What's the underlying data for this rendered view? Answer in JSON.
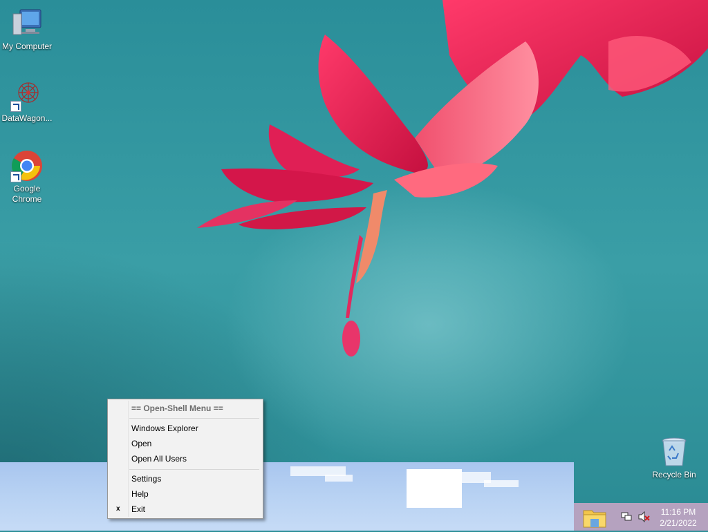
{
  "desktop": {
    "icons": [
      {
        "label": "My Computer",
        "icon": "computer-icon"
      },
      {
        "label": "DataWagon...",
        "icon": "datawagon-icon"
      },
      {
        "label": "Google\nChrome",
        "icon": "chrome-icon"
      },
      {
        "label": "Recycle Bin",
        "icon": "recycle-bin-icon"
      }
    ]
  },
  "context_menu": {
    "header": "== Open-Shell Menu ==",
    "items": [
      {
        "label": "Windows Explorer"
      },
      {
        "label": "Open"
      },
      {
        "label": "Open All Users"
      },
      {
        "label": "Settings"
      },
      {
        "label": "Help"
      },
      {
        "label": "Exit",
        "mark": "x"
      }
    ]
  },
  "taskbar": {
    "clock_time": "11:16 PM",
    "clock_date": "2/21/2022",
    "tray_icons": [
      "network-icon",
      "volume-muted-icon"
    ],
    "pinned": [
      "file-explorer-icon"
    ]
  },
  "colors": {
    "wallpaper": "#2e8f98",
    "flower": "#e0184e",
    "taskbar": "#b8d2f3",
    "tray": "#b5a2bf"
  }
}
